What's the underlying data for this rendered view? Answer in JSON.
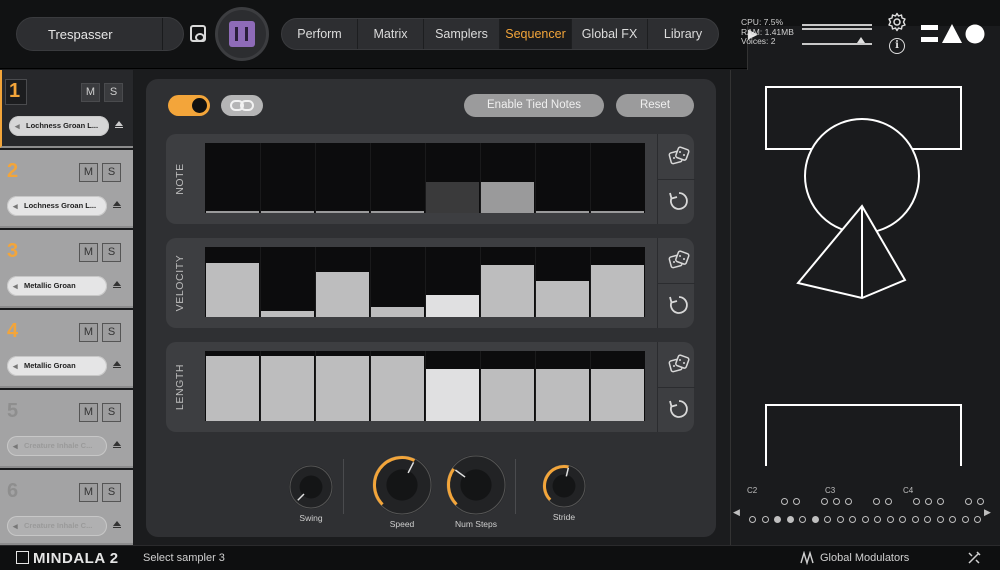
{
  "header": {
    "preset_name": "Trespasser",
    "tabs": [
      {
        "label": "Perform",
        "active": false
      },
      {
        "label": "Matrix",
        "active": false
      },
      {
        "label": "Samplers",
        "active": false
      },
      {
        "label": "Sequencer",
        "active": true
      },
      {
        "label": "Global FX",
        "active": false
      },
      {
        "label": "Library",
        "active": false
      }
    ],
    "stats": {
      "cpu": "CPU: 7.5%",
      "ram": "RAM: 1.41MB",
      "voices": "Voices: 2"
    },
    "info_glyph": "i"
  },
  "sidebar": {
    "slots": [
      {
        "number": "1",
        "mute": "M",
        "solo": "S",
        "sample": "Lochness Groan L...",
        "state": "active"
      },
      {
        "number": "2",
        "mute": "M",
        "solo": "S",
        "sample": "Lochness Groan L...",
        "state": "normal"
      },
      {
        "number": "3",
        "mute": "M",
        "solo": "S",
        "sample": "Metallic Groan",
        "state": "normal"
      },
      {
        "number": "4",
        "mute": "M",
        "solo": "S",
        "sample": "Metallic Groan",
        "state": "normal"
      },
      {
        "number": "5",
        "mute": "M",
        "solo": "S",
        "sample": "Creature Inhale C...",
        "state": "disabled"
      },
      {
        "number": "6",
        "mute": "M",
        "solo": "S",
        "sample": "Creature Inhale C...",
        "state": "disabled"
      }
    ]
  },
  "sequencer": {
    "enabled": true,
    "tied_notes_label": "Enable Tied Notes",
    "reset_label": "Reset",
    "lanes": [
      {
        "label": "NOTE",
        "steps": [
          0.02,
          0.02,
          0.02,
          0.02,
          0.45,
          0.45,
          0.02,
          0.02
        ],
        "colors": [
          "#0c0c0d",
          "#0c0c0d",
          "#0c0c0d",
          "#0c0c0d",
          "#3a3a3b",
          "#9a9a9b",
          "#0c0c0d",
          "#0c0c0d"
        ]
      },
      {
        "label": "VELOCITY",
        "steps": [
          0.77,
          0.08,
          0.64,
          0.14,
          0.31,
          0.74,
          0.51,
          0.74
        ],
        "colors": [
          "#bdbdbe",
          "#bdbdbe",
          "#bdbdbe",
          "#bdbdbe",
          "#e0e0e1",
          "#bdbdbe",
          "#bdbdbe",
          "#bdbdbe"
        ]
      },
      {
        "label": "LENGTH",
        "steps": [
          0.93,
          0.93,
          0.93,
          0.93,
          0.74,
          0.74,
          0.74,
          0.74
        ],
        "colors": [
          "#bdbdbe",
          "#bdbdbe",
          "#bdbdbe",
          "#bdbdbe",
          "#e0e0e1",
          "#bdbdbe",
          "#bdbdbe",
          "#bdbdbe"
        ]
      }
    ],
    "knobs": [
      {
        "label": "Swing",
        "value": 0.0
      },
      {
        "label": "Speed",
        "value": 0.6
      },
      {
        "label": "Num Steps",
        "value": 0.3
      },
      {
        "label": "Stride",
        "value": 0.55
      }
    ]
  },
  "keyboard": {
    "labels": [
      "C2",
      "C3",
      "C4"
    ],
    "active_row": [
      false,
      false,
      true,
      true,
      false,
      true,
      false,
      false,
      false,
      false,
      false,
      false,
      false,
      false,
      false,
      false,
      false,
      false,
      false
    ]
  },
  "footer": {
    "brand": "MINDALA 2",
    "status": "Select sampler 3",
    "global_modulators": "Global Modulators"
  },
  "colors": {
    "accent": "#f3a53a"
  }
}
